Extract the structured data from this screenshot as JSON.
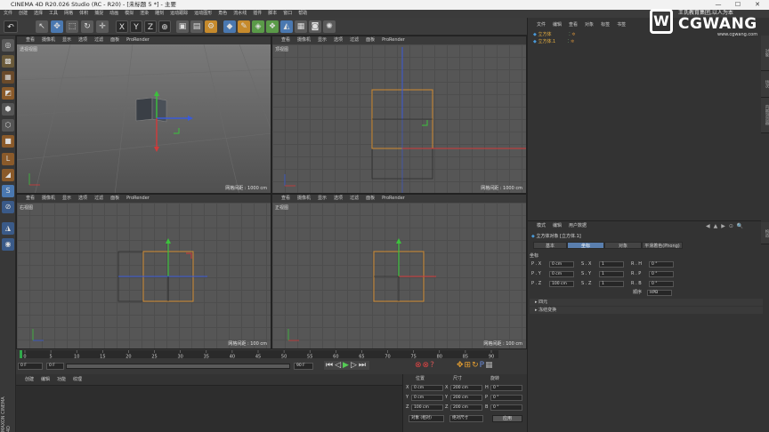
{
  "window": {
    "title": "CINEMA 4D R20.026 Studio (RC - R20) - [未标题 5 *] - 主要",
    "minimize": "—",
    "maximize": "☐",
    "close": "✕"
  },
  "menubar": [
    "文件",
    "创建",
    "选择",
    "工具",
    "网格",
    "体积",
    "捕捉",
    "动画",
    "模拟",
    "渲染",
    "雕刻",
    "运动跟踪",
    "运动图形",
    "角色",
    "流水线",
    "插件",
    "脚本",
    "窗口",
    "帮助"
  ],
  "viewports": {
    "header_items": [
      "查看",
      "摄像机",
      "显示",
      "选项",
      "过滤",
      "面板",
      "ProRender"
    ],
    "perspective": {
      "label": "透视视图",
      "footer": "网格间距 : 1000 cm"
    },
    "top": {
      "label": "顶视图",
      "footer": "网格间距 : 1000 cm"
    },
    "right": {
      "label": "右视图",
      "footer": "网格间距 : 100 cm"
    },
    "front": {
      "label": "正视图",
      "footer": "网格间距 : 100 cm"
    }
  },
  "object_manager": {
    "tabs": [
      "文件",
      "编辑",
      "查看",
      "对象",
      "标签",
      "书签"
    ],
    "objects": [
      "立方体",
      "立方体.1"
    ]
  },
  "attribute_manager": {
    "tabs": [
      "模式",
      "编辑",
      "用户数据"
    ],
    "object_title": "立方体对象 [立方体.1]",
    "sub_tabs": [
      "基本",
      "坐标",
      "对象",
      "平滑着色(Phong)"
    ],
    "section": "坐标",
    "pos": [
      {
        "label": "P . X",
        "value": "0 cm"
      },
      {
        "label": "P . Y",
        "value": "0 cm"
      },
      {
        "label": "P . Z",
        "value": "100 cm"
      }
    ],
    "scale": [
      {
        "label": "S . X",
        "value": "1"
      },
      {
        "label": "S . Y",
        "value": "1"
      },
      {
        "label": "S . Z",
        "value": "1"
      }
    ],
    "rot": [
      {
        "label": "R . H",
        "value": "0 °"
      },
      {
        "label": "R . P",
        "value": "0 °"
      },
      {
        "label": "R . B",
        "value": "0 °"
      }
    ],
    "order_label": "顺序",
    "order_value": "HPB",
    "collapsed": [
      "四元",
      "冻结变换"
    ]
  },
  "timeline": {
    "ticks": [
      "0",
      "5",
      "10",
      "15",
      "20",
      "25",
      "30",
      "35",
      "40",
      "45",
      "50",
      "55",
      "60",
      "65",
      "70",
      "75",
      "80",
      "85",
      "90"
    ],
    "current_frame": "0 F",
    "start": "0 F",
    "min": "0 F",
    "end": "90 F",
    "max": "90 F"
  },
  "material_manager": {
    "tabs": [
      "创建",
      "编辑",
      "功能",
      "纹理"
    ]
  },
  "coordinates": {
    "headers": [
      "位置",
      "尺寸",
      "旋转"
    ],
    "rows": [
      {
        "axis": "X",
        "pos": "0 cm",
        "size": "200 cm",
        "rot_axis": "H",
        "rot": "0 °"
      },
      {
        "axis": "Y",
        "pos": "0 cm",
        "size": "200 cm",
        "rot_axis": "P",
        "rot": "0 °"
      },
      {
        "axis": "Z",
        "pos": "100 cm",
        "size": "200 cm",
        "rot_axis": "B",
        "rot": "0 °"
      }
    ],
    "mode1": "对象 (相对)",
    "mode2": "绝对尺寸",
    "apply": "应用"
  },
  "watermark": {
    "line1": "王氏教育集团,以人为本",
    "logo": "CGWANG",
    "url": "www.cgwang.com"
  },
  "side_brand": "MAXON CINEMA 4D",
  "right_vtabs": [
    "对象",
    "场次",
    "内容浏览器",
    "构造"
  ],
  "colors": {
    "axis_x": "#d23a3a",
    "axis_y": "#3cc23c",
    "axis_z": "#3a5ad8",
    "cube_edge": "#d08a30",
    "accent": "#4a78b0"
  }
}
